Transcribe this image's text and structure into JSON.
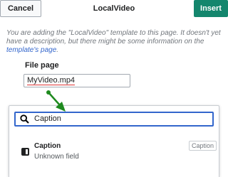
{
  "header": {
    "cancel_label": "Cancel",
    "title": "LocalVideo",
    "insert_label": "Insert"
  },
  "notice": {
    "text_before": "You are adding the \"LocalVideo\" template to this page. It doesn't yet have a description, but there might be some information on the ",
    "link_text": "template's page",
    "text_after": "."
  },
  "field": {
    "label": "File page",
    "value": "MyVideo.mp4"
  },
  "search": {
    "value": "Caption",
    "icon": "search-icon"
  },
  "result": {
    "name": "Caption",
    "description": "Unknown field",
    "key": "Caption",
    "icon": "parameter-icon"
  },
  "colors": {
    "accent": "#3366cc",
    "insert": "#14866d",
    "arrow": "#1f8a1f"
  }
}
